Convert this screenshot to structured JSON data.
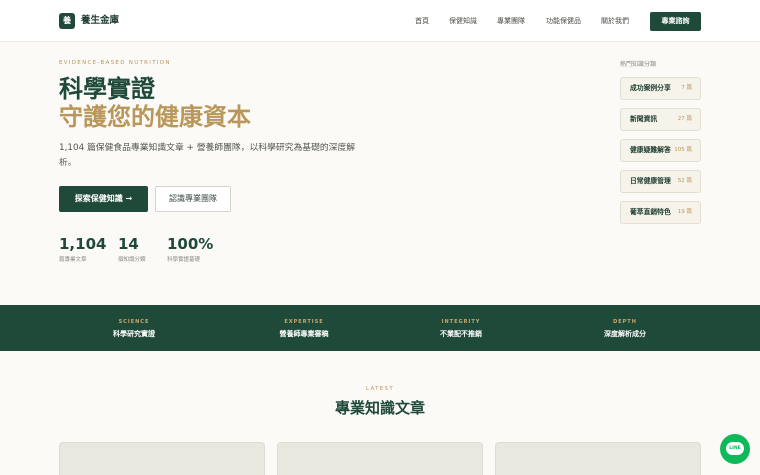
{
  "brand": {
    "logo_char": "養",
    "name": "養生金庫"
  },
  "nav": {
    "links": [
      "首頁",
      "保健知識",
      "專業團隊",
      "功能保健品",
      "關於我們"
    ],
    "cta": "專業諮詢"
  },
  "hero": {
    "eyebrow": "EVIDENCE-BASED NUTRITION",
    "title_line1": "科學實證",
    "title_line2": "守護您的健康資本",
    "lead": "1,104 篇保健食品專業知識文章 + 營養師團隊，以科學研究為基礎的深度解析。",
    "primary_button": "探索保健知識 →",
    "secondary_button": "認識專業團隊",
    "stats": [
      {
        "value": "1,104",
        "label": "篇專業文章"
      },
      {
        "value": "14",
        "label": "個知識分類"
      },
      {
        "value": "100%",
        "label": "科學實證基礎"
      }
    ]
  },
  "sidebar": {
    "title": "熱門知識分類",
    "categories": [
      {
        "name": "成功案例分享",
        "count": "7 篇"
      },
      {
        "name": "新聞資訊",
        "count": "27 篇"
      },
      {
        "name": "健康疑難解答",
        "count": "105 篇"
      },
      {
        "name": "日常健康管理",
        "count": "52 篇"
      },
      {
        "name": "葡萃直銷特色",
        "count": "19 篇"
      }
    ]
  },
  "pillars": [
    {
      "en": "SCIENCE",
      "zh": "科學研究實證"
    },
    {
      "en": "EXPERTISE",
      "zh": "營養師專業審稿"
    },
    {
      "en": "INTEGRITY",
      "zh": "不業配不推銷"
    },
    {
      "en": "DEPTH",
      "zh": "深度解析成分"
    }
  ],
  "latest": {
    "eyebrow": "LATEST",
    "title": "專業知識文章"
  },
  "chat": {
    "label": "LINE"
  },
  "colors": {
    "primary": "#1f4a39",
    "accent": "#b9975b",
    "chat": "#0fb85a"
  }
}
